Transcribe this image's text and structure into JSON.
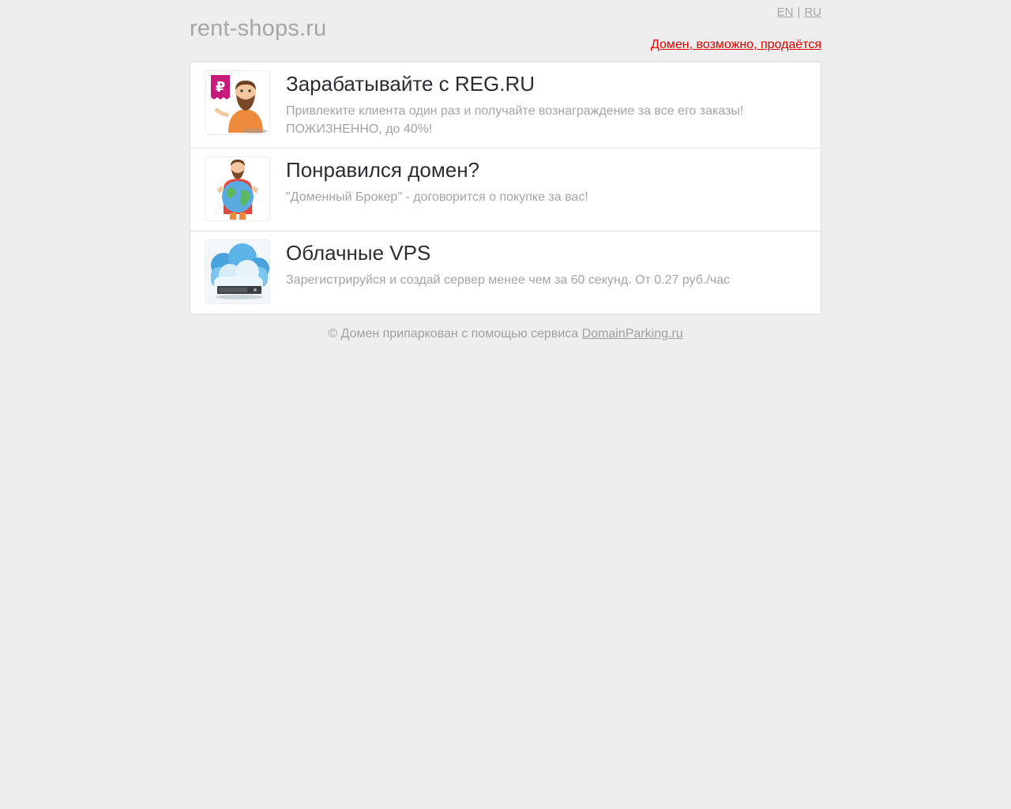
{
  "header": {
    "site_title": "rent-shops.ru",
    "lang_en": "EN",
    "lang_sep": "|",
    "lang_ru": "RU",
    "sale_link": "Домен, возможно, продаётся"
  },
  "cards": [
    {
      "title": "Зарабатывайте с REG.RU",
      "text": "Привлеките клиента один раз и получайте вознаграждение за все его заказы! ПОЖИЗНЕННО, до 40%!",
      "icon": "ruble-man-icon"
    },
    {
      "title": "Понравился домен?",
      "text": "\"Доменный Брокер\" - договорится о покупке за вас!",
      "icon": "globe-man-icon"
    },
    {
      "title": "Облачные VPS",
      "text": "Зарегистрируйся и создай сервер менее чем за 60 секунд. От 0.27 руб./час",
      "icon": "cloud-server-icon"
    }
  ],
  "footer": {
    "text": "© Домен припаркован с помощью сервиса ",
    "link": "DomainParking.ru"
  },
  "colors": {
    "background": "#eeeeee",
    "sale_link": "#e00000",
    "title": "#2a2e33",
    "muted": "#a4a4a4"
  }
}
